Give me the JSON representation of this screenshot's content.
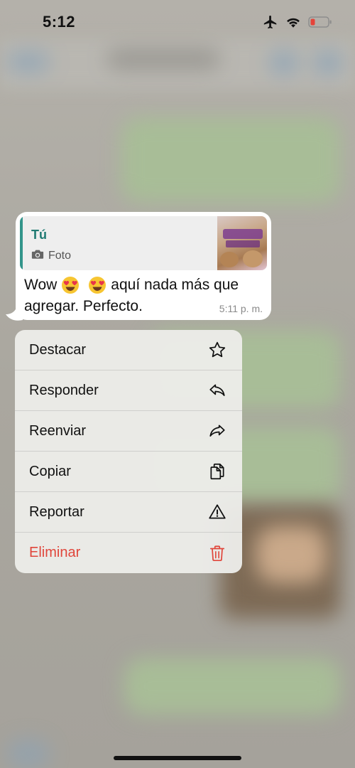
{
  "status_bar": {
    "time": "5:12",
    "icons": [
      "airplane-icon",
      "wifi-icon",
      "battery-low-icon"
    ],
    "battery_color": "#e5443a"
  },
  "message": {
    "quote": {
      "author": "Tú",
      "kind_icon": "camera-icon",
      "kind_label": "Foto",
      "accent_color": "#33958b"
    },
    "text_line1_a": "Wow",
    "text_line1_b": "aquí nada más que",
    "text_line2": "agregar. Perfecto.",
    "emoji": [
      "heart-eyes-emoji",
      "heart-eyes-emoji"
    ],
    "time": "5:11 p. m."
  },
  "context_menu": {
    "items": [
      {
        "label": "Destacar",
        "icon": "star-icon"
      },
      {
        "label": "Responder",
        "icon": "reply-icon"
      },
      {
        "label": "Reenviar",
        "icon": "forward-icon"
      },
      {
        "label": "Copiar",
        "icon": "copy-icon"
      },
      {
        "label": "Reportar",
        "icon": "warning-icon"
      },
      {
        "label": "Eliminar",
        "icon": "trash-icon"
      }
    ],
    "danger_color": "#e0463b"
  }
}
